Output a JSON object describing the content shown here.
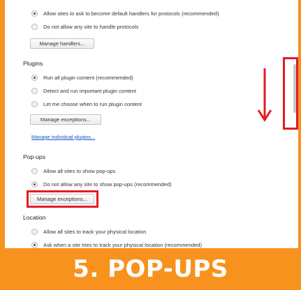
{
  "protocols": {
    "options": [
      {
        "label": "Allow sites to ask to become default handlers for protocols (recommended)",
        "checked": true
      },
      {
        "label": "Do not allow any site to handle protocols",
        "checked": false
      }
    ],
    "button": "Manage handlers..."
  },
  "plugins": {
    "heading": "Plugins",
    "options": [
      {
        "label": "Run all plugin content (recommended)",
        "checked": true
      },
      {
        "label": "Detect and run important plugin content",
        "checked": false
      },
      {
        "label": "Let me choose when to run plugin content",
        "checked": false
      }
    ],
    "button": "Manage exceptions...",
    "link": "Manage individual plugins..."
  },
  "popups": {
    "heading": "Pop-ups",
    "options": [
      {
        "label": "Allow all sites to show pop-ups",
        "checked": false
      },
      {
        "label": "Do not allow any site to show pop-ups (recommended)",
        "checked": true
      }
    ],
    "button": "Manage exceptions..."
  },
  "location": {
    "heading": "Location",
    "options": [
      {
        "label": "Allow all sites to track your physical location",
        "checked": false
      },
      {
        "label": "Ask when a site tries to track your physical location (recommended)",
        "checked": true
      }
    ]
  },
  "banner": {
    "text": "5. POP-UPS"
  },
  "colors": {
    "accent": "#f7921e",
    "highlight": "#e31b23",
    "link": "#1155cc"
  },
  "annotations": {
    "arrow": "down-arrow-icon"
  }
}
